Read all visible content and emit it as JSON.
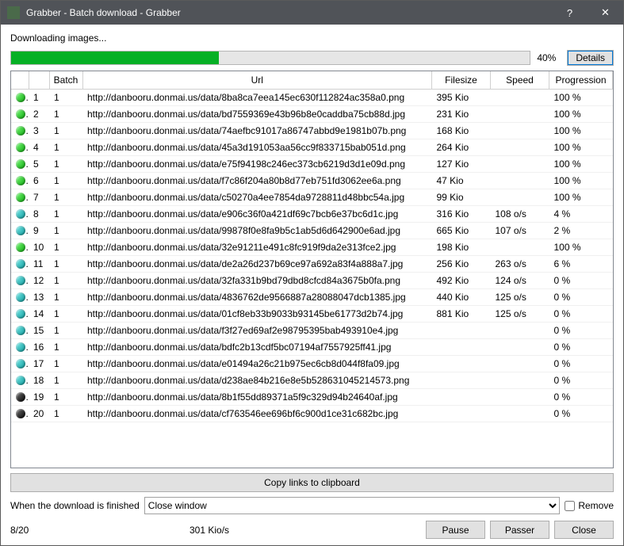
{
  "titlebar": {
    "title": "Grabber - Batch download - Grabber"
  },
  "status_text": "Downloading images...",
  "progress": {
    "percent": 40,
    "label": "40%"
  },
  "details_btn": "Details",
  "columns": {
    "batch": "Batch",
    "url": "Url",
    "filesize": "Filesize",
    "speed": "Speed",
    "progression": "Progression"
  },
  "rows": [
    {
      "idx": 1,
      "batch": 1,
      "url": "http://danbooru.donmai.us/data/8ba8ca7eea145ec630f112824ac358a0.png",
      "filesize": "395 Kio",
      "speed": "",
      "prog": "100 %",
      "status": "green"
    },
    {
      "idx": 2,
      "batch": 1,
      "url": "http://danbooru.donmai.us/data/bd7559369e43b96b8e0caddba75cb88d.jpg",
      "filesize": "231 Kio",
      "speed": "",
      "prog": "100 %",
      "status": "green"
    },
    {
      "idx": 3,
      "batch": 1,
      "url": "http://danbooru.donmai.us/data/74aefbc91017a86747abbd9e1981b07b.png",
      "filesize": "168 Kio",
      "speed": "",
      "prog": "100 %",
      "status": "green"
    },
    {
      "idx": 4,
      "batch": 1,
      "url": "http://danbooru.donmai.us/data/45a3d191053aa56cc9f833715bab051d.png",
      "filesize": "264 Kio",
      "speed": "",
      "prog": "100 %",
      "status": "green"
    },
    {
      "idx": 5,
      "batch": 1,
      "url": "http://danbooru.donmai.us/data/e75f94198c246ec373cb6219d3d1e09d.png",
      "filesize": "127 Kio",
      "speed": "",
      "prog": "100 %",
      "status": "green"
    },
    {
      "idx": 6,
      "batch": 1,
      "url": "http://danbooru.donmai.us/data/f7c86f204a80b8d77eb751fd3062ee6a.png",
      "filesize": "47 Kio",
      "speed": "",
      "prog": "100 %",
      "status": "green"
    },
    {
      "idx": 7,
      "batch": 1,
      "url": "http://danbooru.donmai.us/data/c50270a4ee7854da9728811d48bbc54a.jpg",
      "filesize": "99 Kio",
      "speed": "",
      "prog": "100 %",
      "status": "green"
    },
    {
      "idx": 8,
      "batch": 1,
      "url": "http://danbooru.donmai.us/data/e906c36f0a421df69c7bcb6e37bc6d1c.jpg",
      "filesize": "316 Kio",
      "speed": "108 o/s",
      "prog": "4 %",
      "status": "teal"
    },
    {
      "idx": 9,
      "batch": 1,
      "url": "http://danbooru.donmai.us/data/99878f0e8fa9b5c1ab5d6d642900e6ad.jpg",
      "filesize": "665 Kio",
      "speed": "107 o/s",
      "prog": "2 %",
      "status": "teal"
    },
    {
      "idx": 10,
      "batch": 1,
      "url": "http://danbooru.donmai.us/data/32e91211e491c8fc919f9da2e313fce2.jpg",
      "filesize": "198 Kio",
      "speed": "",
      "prog": "100 %",
      "status": "green"
    },
    {
      "idx": 11,
      "batch": 1,
      "url": "http://danbooru.donmai.us/data/de2a26d237b69ce97a692a83f4a888a7.jpg",
      "filesize": "256 Kio",
      "speed": "263 o/s",
      "prog": "6 %",
      "status": "teal"
    },
    {
      "idx": 12,
      "batch": 1,
      "url": "http://danbooru.donmai.us/data/32fa331b9bd79dbd8cfcd84a3675b0fa.png",
      "filesize": "492 Kio",
      "speed": "124 o/s",
      "prog": "0 %",
      "status": "teal"
    },
    {
      "idx": 13,
      "batch": 1,
      "url": "http://danbooru.donmai.us/data/4836762de9566887a28088047dcb1385.jpg",
      "filesize": "440 Kio",
      "speed": "125 o/s",
      "prog": "0 %",
      "status": "teal"
    },
    {
      "idx": 14,
      "batch": 1,
      "url": "http://danbooru.donmai.us/data/01cf8eb33b9033b93145be61773d2b74.jpg",
      "filesize": "881 Kio",
      "speed": "125 o/s",
      "prog": "0 %",
      "status": "teal"
    },
    {
      "idx": 15,
      "batch": 1,
      "url": "http://danbooru.donmai.us/data/f3f27ed69af2e98795395bab493910e4.jpg",
      "filesize": "",
      "speed": "",
      "prog": "0 %",
      "status": "teal"
    },
    {
      "idx": 16,
      "batch": 1,
      "url": "http://danbooru.donmai.us/data/bdfc2b13cdf5bc07194af7557925ff41.jpg",
      "filesize": "",
      "speed": "",
      "prog": "0 %",
      "status": "teal"
    },
    {
      "idx": 17,
      "batch": 1,
      "url": "http://danbooru.donmai.us/data/e01494a26c21b975ec6cb8d044f8fa09.jpg",
      "filesize": "",
      "speed": "",
      "prog": "0 %",
      "status": "teal"
    },
    {
      "idx": 18,
      "batch": 1,
      "url": "http://danbooru.donmai.us/data/d238ae84b216e8e5b528631045214573.png",
      "filesize": "",
      "speed": "",
      "prog": "0 %",
      "status": "teal"
    },
    {
      "idx": 19,
      "batch": 1,
      "url": "http://danbooru.donmai.us/data/8b1f55dd89371a5f9c329d94b24640af.jpg",
      "filesize": "",
      "speed": "",
      "prog": "0 %",
      "status": "black"
    },
    {
      "idx": 20,
      "batch": 1,
      "url": "http://danbooru.donmai.us/data/cf763546ee696bf6c900d1ce31c682bc.jpg",
      "filesize": "",
      "speed": "",
      "prog": "0 %",
      "status": "black"
    }
  ],
  "copy_btn": "Copy links to clipboard",
  "finish": {
    "label": "When the download is finished",
    "selected": "Close window",
    "remove_label": "Remove"
  },
  "footer": {
    "done_of_total": "8/20",
    "total_speed": "301 Kio/s",
    "pause": "Pause",
    "skip": "Passer",
    "close": "Close"
  }
}
